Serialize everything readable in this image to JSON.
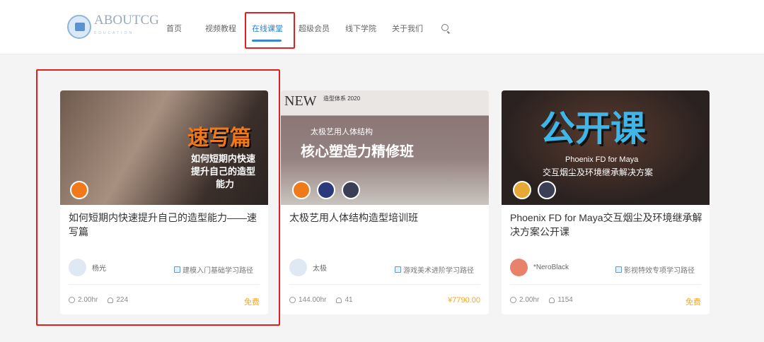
{
  "logo": {
    "name": "ABOUTCG",
    "sub": "EDUCATION"
  },
  "nav": [
    "首页",
    "视频教程",
    "在线课堂",
    "超级会员",
    "线下学院",
    "关于我们"
  ],
  "active_nav": "在线课堂",
  "accent": "#2d7dd2",
  "courses": [
    {
      "title": "如何短期内快速提升自己的造型能力——速写篇",
      "author": "杨光",
      "path": "建模入门基础学习路径",
      "duration": "2.00hr",
      "students": "224",
      "price": "免费",
      "banner": {
        "t1": "速写篇",
        "t2": "如何短期内快速",
        "t3": "提升自己的造型",
        "t4": "能力"
      }
    },
    {
      "title": "太极艺用人体结构造型培训班",
      "author": "太极",
      "path": "游戏美术进阶学习路径",
      "duration": "144.00hr",
      "students": "41",
      "price": "¥7790.00",
      "banner": {
        "t1": "NEW",
        "t2": "造型体系 2020",
        "t3": "太极艺用人体结构",
        "t4": "核心塑造力精修班"
      }
    },
    {
      "title": "Phoenix FD for Maya交互烟尘及环境继承解决方案公开课",
      "author": "*NeroBlack",
      "path": "影视特效专项学习路径",
      "duration": "2.00hr",
      "students": "1154",
      "price": "免费",
      "banner": {
        "t1": "公开课",
        "t2": "Phoenix FD for Maya",
        "t3": "交互烟尘及环境继承解决方案"
      }
    }
  ]
}
